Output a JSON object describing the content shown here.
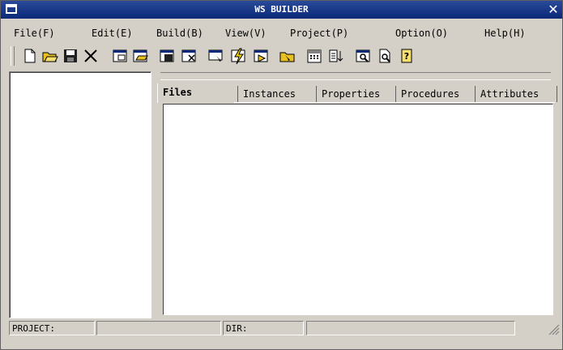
{
  "window": {
    "title": "WS BUILDER"
  },
  "menu": [
    "File(F)",
    "Edit(E)",
    "Build(B)",
    "View(V)",
    "Project(P)",
    "Option(O)",
    "Help(H)"
  ],
  "toolbar": [
    "new-file-icon",
    "open-folder-icon",
    "save-icon",
    "delete-icon",
    "new-window-icon",
    "open-window-icon",
    "save-window-icon",
    "close-window-icon",
    "select-icon",
    "build-icon",
    "run-icon",
    "folder-arrow-icon",
    "calendar-icon",
    "list-sort-icon",
    "window-search-icon",
    "document-search-icon",
    "help-icon"
  ],
  "tabs": [
    "Files",
    "Instances",
    "Properties",
    "Procedures",
    "Attributes"
  ],
  "active_tab": "Files",
  "status": {
    "project_label": "PROJECT:",
    "project_value": "",
    "dir_label": "DIR:",
    "dir_value": ""
  },
  "colors": {
    "titlebar": "#0a2878",
    "chrome": "#d4d0c8"
  }
}
